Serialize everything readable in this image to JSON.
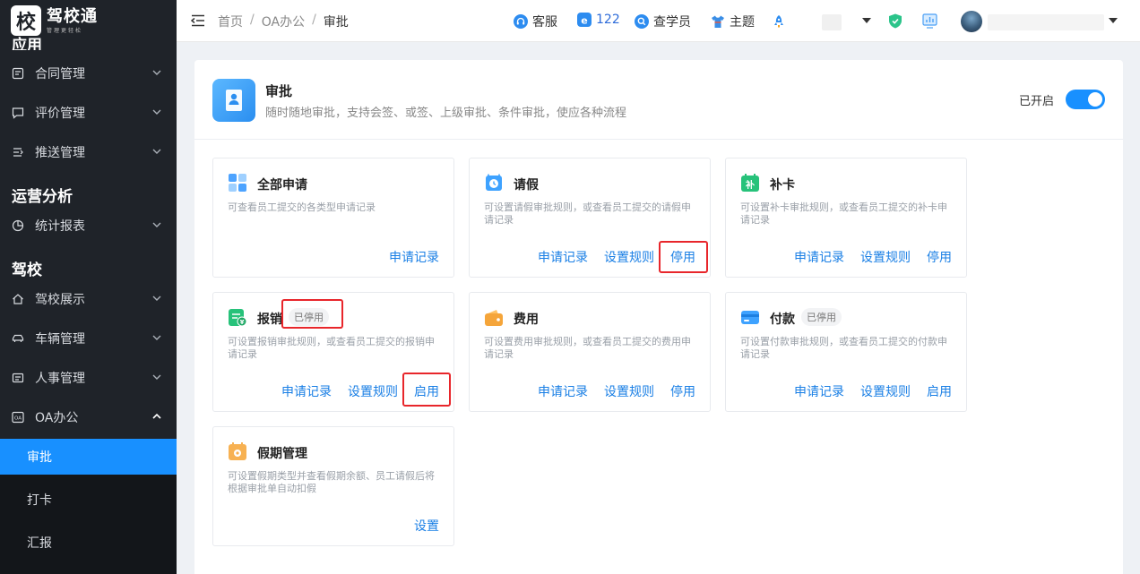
{
  "logo": {
    "char": "校",
    "name": "驾校通",
    "slogan": "管理更轻松"
  },
  "sidebar": {
    "top_partial": "应用",
    "groups": [
      {
        "title": "运营分析"
      },
      {
        "title": "驾校"
      }
    ],
    "items": [
      {
        "label": "合同管理"
      },
      {
        "label": "评价管理"
      },
      {
        "label": "推送管理"
      },
      {
        "label": "统计报表"
      },
      {
        "label": "驾校展示"
      },
      {
        "label": "车辆管理"
      },
      {
        "label": "人事管理"
      },
      {
        "label": "OA办公"
      }
    ],
    "sub_items": [
      {
        "label": "审批"
      },
      {
        "label": "打卡"
      },
      {
        "label": "汇报"
      }
    ]
  },
  "header": {
    "breadcrumb": [
      "首页",
      "OA办公",
      "审批"
    ],
    "service": "客服",
    "count": "122",
    "search_student": "查学员",
    "theme": "主题"
  },
  "main": {
    "title": "审批",
    "description": "随时随地审批，支持会签、或签、上级审批、条件审批，使应各种流程",
    "switch_label": "已开启",
    "cards": [
      {
        "title": "全部申请",
        "badge": "",
        "desc": "可查看员工提交的各类型申请记录",
        "actions": [
          "申请记录"
        ]
      },
      {
        "title": "请假",
        "badge": "",
        "desc": "可设置请假审批规则，或查看员工提交的请假申请记录",
        "actions": [
          "申请记录",
          "设置规则",
          "停用"
        ]
      },
      {
        "title": "补卡",
        "badge": "",
        "desc": "可设置补卡审批规则，或查看员工提交的补卡申请记录",
        "actions": [
          "申请记录",
          "设置规则",
          "停用"
        ]
      },
      {
        "title": "报销",
        "badge": "已停用",
        "desc": "可设置报销审批规则，或查看员工提交的报销申请记录",
        "actions": [
          "申请记录",
          "设置规则",
          "启用"
        ]
      },
      {
        "title": "费用",
        "badge": "",
        "desc": "可设置费用审批规则，或查看员工提交的费用申请记录",
        "actions": [
          "申请记录",
          "设置规则",
          "停用"
        ]
      },
      {
        "title": "付款",
        "badge": "已停用",
        "desc": "可设置付款审批规则，或查看员工提交的付款申请记录",
        "actions": [
          "申请记录",
          "设置规则",
          "启用"
        ]
      },
      {
        "title": "假期管理",
        "badge": "",
        "desc": "可设置假期类型并查看假期余额、员工请假后将根据审批单自动扣假",
        "actions": [
          "设置"
        ]
      }
    ]
  },
  "colors": {
    "accent": "#1890ff",
    "sidebar_bg": "#1f2329",
    "highlight": "#e8262b"
  }
}
